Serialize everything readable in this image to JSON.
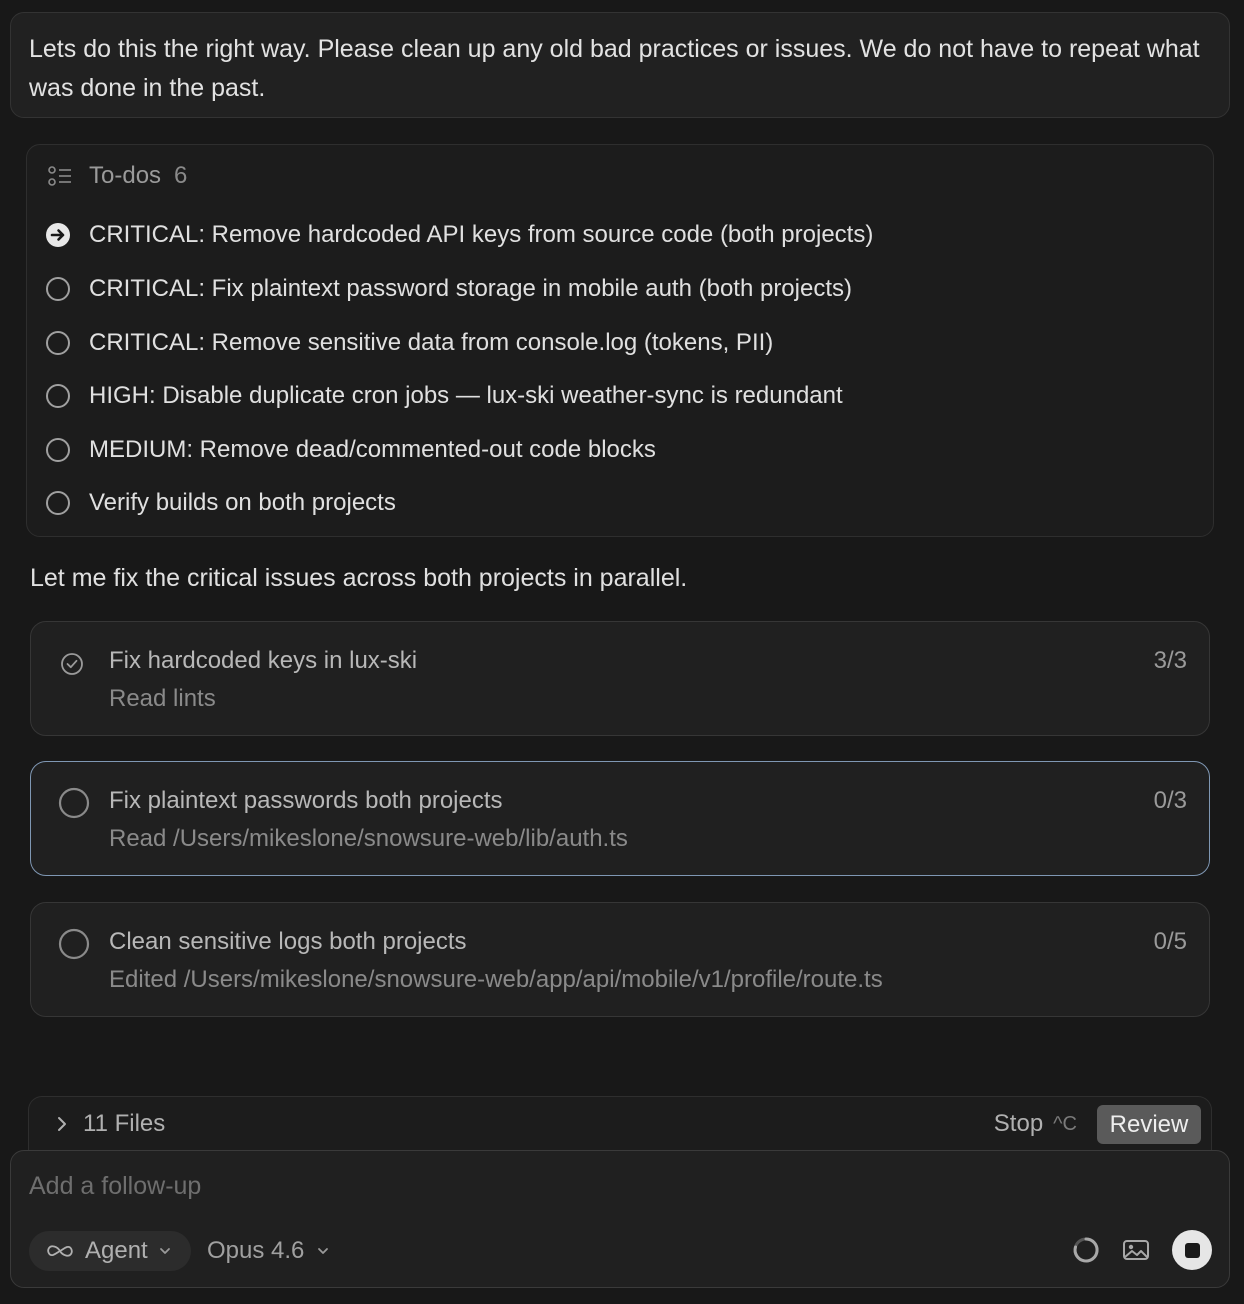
{
  "user_message": "Lets do this the right way. Please clean up any old bad practices or issues. We do not have to repeat what was done in the past.",
  "todos": {
    "title": "To-dos",
    "count": "6",
    "items": [
      {
        "label": "CRITICAL: Remove hardcoded API keys from source code (both projects)",
        "status": "in-progress"
      },
      {
        "label": "CRITICAL: Fix plaintext password storage in mobile auth (both projects)",
        "status": "pending"
      },
      {
        "label": "CRITICAL: Remove sensitive data from console.log (tokens, PII)",
        "status": "pending"
      },
      {
        "label": "HIGH: Disable duplicate cron jobs — lux-ski weather-sync is redundant",
        "status": "pending"
      },
      {
        "label": "MEDIUM: Remove dead/commented-out code blocks",
        "status": "pending"
      },
      {
        "label": "Verify builds on both projects",
        "status": "pending"
      }
    ]
  },
  "assistant_intro": "Let me fix the critical issues across both projects in parallel.",
  "tasks": [
    {
      "title": "Fix hardcoded keys in lux-ski",
      "subtitle": "Read lints",
      "count": "3/3",
      "status": "done"
    },
    {
      "title": "Fix plaintext passwords both projects",
      "subtitle": "Read /Users/mikeslone/snowsure-web/lib/auth.ts",
      "count": "0/3",
      "status": "running"
    },
    {
      "title": "Clean sensitive logs both projects",
      "subtitle": "Edited /Users/mikeslone/snowsure-web/app/api/mobile/v1/profile/route.ts",
      "count": "0/5",
      "status": "pending"
    }
  ],
  "files_bar": {
    "label": "11 Files",
    "stop_label": "Stop",
    "stop_shortcut": "^C",
    "review_label": "Review"
  },
  "composer": {
    "placeholder": "Add a follow-up",
    "mode": "Agent",
    "model": "Opus 4.6"
  },
  "icons": {
    "todo_header": "list-icon",
    "todo_active": "arrow-circle-icon",
    "todo_pending": "empty-circle-icon",
    "task_done": "check-circle-icon",
    "task_pending": "empty-circle-icon",
    "mode": "infinity-icon",
    "dropdown": "chevron-down-icon",
    "files_toggle": "chevron-right-icon",
    "context": "context-ring-icon",
    "attach": "image-icon",
    "stop": "stop-icon"
  },
  "colors": {
    "background": "#181818",
    "active_border": "#7f97b3",
    "review_button": "#5a5a5a"
  }
}
